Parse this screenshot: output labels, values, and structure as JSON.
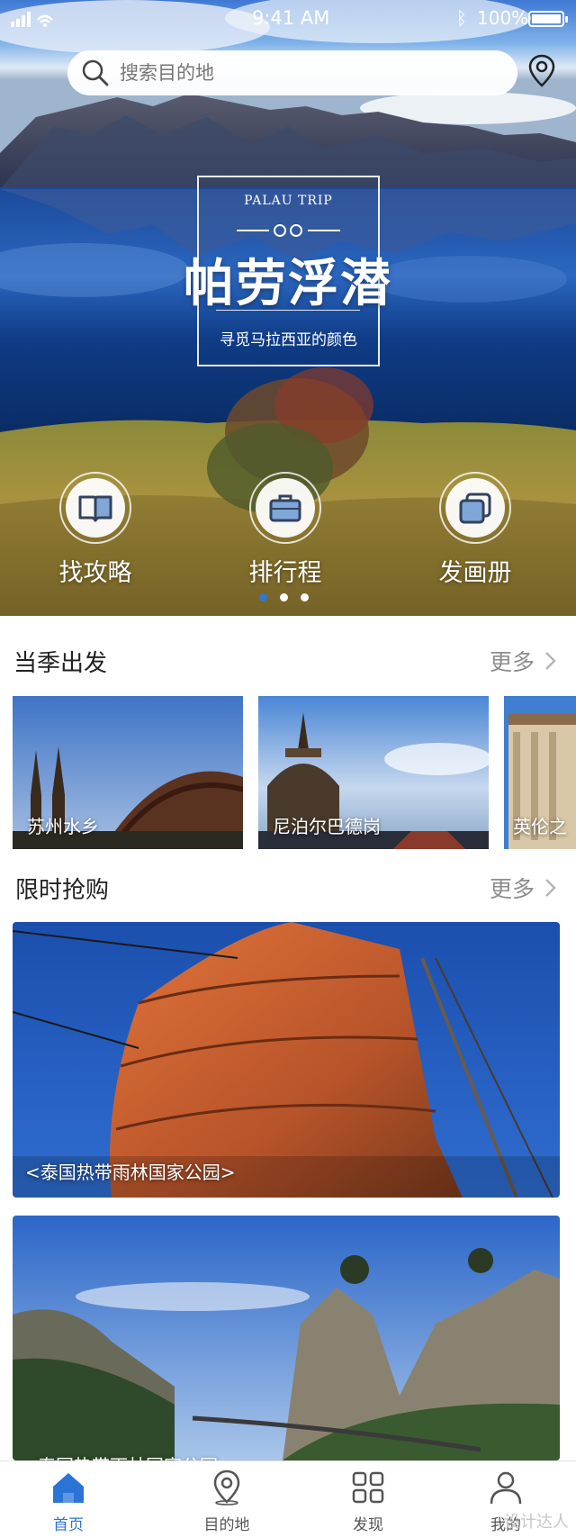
{
  "status_bar": {
    "time": "9:41 AM",
    "battery": "100%",
    "bluetooth_icon": "bluetooth-icon"
  },
  "search": {
    "placeholder": "搜索目的地"
  },
  "banner": {
    "subtitle_en": "PALAU TRIP",
    "title": "帕劳浮潜",
    "subtitle": "寻觅马拉西亚的颜色"
  },
  "quick_actions": [
    {
      "label": "找攻略",
      "icon": "book-icon"
    },
    {
      "label": "排行程",
      "icon": "briefcase-icon"
    },
    {
      "label": "发画册",
      "icon": "album-icon"
    }
  ],
  "carousel": {
    "total": 3,
    "active": 0
  },
  "season": {
    "title": "当季出发",
    "more": "更多",
    "items": [
      {
        "label": "苏州水乡"
      },
      {
        "label": "尼泊尔巴德岗"
      },
      {
        "label": "英伦之"
      }
    ]
  },
  "flash_sale": {
    "title": "限时抢购",
    "more": "更多",
    "items": [
      {
        "label": "<泰国热带雨林国家公园>"
      },
      {
        "label": "泰国热带雨林国家公园"
      }
    ]
  },
  "tabbar": {
    "tabs": [
      {
        "label": "首页",
        "icon": "home-icon",
        "active": true
      },
      {
        "label": "目的地",
        "icon": "location-pin-icon",
        "active": false
      },
      {
        "label": "发现",
        "icon": "grid-icon",
        "active": false
      },
      {
        "label": "我的",
        "icon": "user-icon",
        "active": false
      }
    ]
  },
  "watermark": "设计达人",
  "colors": {
    "accent": "#2a74d6",
    "text_primary": "#222222",
    "text_secondary": "#8d8d8d"
  }
}
